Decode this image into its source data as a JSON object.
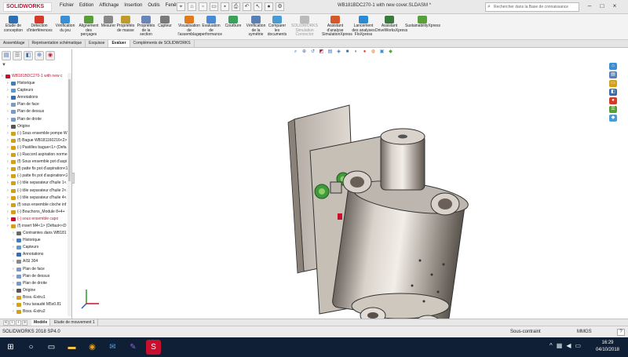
{
  "app": {
    "logo_text": "SOLIDWORKS",
    "document_title": "WB181BDC270-1 with new cover.SLDASM *"
  },
  "menu": [
    "Fichier",
    "Edition",
    "Affichage",
    "Insertion",
    "Outils",
    "Fenêtre",
    "?"
  ],
  "search": {
    "placeholder": "Rechercher dans la Base de connaissance"
  },
  "ribbon": [
    {
      "label": "Etude de conception",
      "color": "#2d6fb5"
    },
    {
      "label": "Détection d'interférences",
      "color": "#d43b2a"
    },
    {
      "label": "Vérification du jeu",
      "color": "#3a8ed4"
    },
    {
      "label": "Alignement des perçages",
      "color": "#5a9e3a"
    },
    {
      "label": "Mesurer",
      "color": "#888888"
    },
    {
      "label": "Propriétés de masse",
      "color": "#c09a2a"
    },
    {
      "label": "Propriétés de la section",
      "color": "#6a86b8"
    },
    {
      "label": "Capteur",
      "color": "#7a7a7a"
    },
    {
      "label": "Visualisation de l'assemblage",
      "color": "#e07a1a"
    },
    {
      "label": "Evaluation de performance",
      "color": "#4a8ad4"
    },
    {
      "label": "Courbure",
      "color": "#3aa05a"
    },
    {
      "label": "Vérification de la symétrie",
      "color": "#5a7fb5"
    },
    {
      "label": "Comparer les documents",
      "color": "#4a9ad4"
    },
    {
      "label": "SOLIDWORKS Simulation Connector",
      "color": "#bbbbbb",
      "disabled": true
    },
    {
      "label": "Assistant d'analyse SimulationXpress",
      "color": "#d45a2a"
    },
    {
      "label": "Lancement des analyses FloXpress",
      "color": "#2a8ad4"
    },
    {
      "label": "Assistant DriveWorksXpress",
      "color": "#3a7a3a"
    },
    {
      "label": "SustainabilityXpress",
      "color": "#5aa03a"
    }
  ],
  "tabs": [
    "Assemblage",
    "Représentation schématique",
    "Esquisse",
    "Evaluer",
    "Compléments de SOLIDWORKS"
  ],
  "active_tab": "Evaluer",
  "tree": [
    {
      "label": "WB181BDC270-1 with new c",
      "indent": 0,
      "color": "#c8102e",
      "red": true
    },
    {
      "label": "Historique",
      "indent": 1,
      "color": "#4a7ab5"
    },
    {
      "label": "Capteurs",
      "indent": 1,
      "color": "#5a9ad4"
    },
    {
      "label": "Annotations",
      "indent": 1,
      "color": "#3a6ab0"
    },
    {
      "label": "Plan de face",
      "indent": 1,
      "color": "#7a9ac8"
    },
    {
      "label": "Plan de dessus",
      "indent": 1,
      "color": "#7a9ac8"
    },
    {
      "label": "Plan de droite",
      "indent": 1,
      "color": "#7a9ac8"
    },
    {
      "label": "Origine",
      "indent": 1,
      "color": "#555555"
    },
    {
      "label": "(-) Sous ensemble pompe W",
      "indent": 1,
      "color": "#d4a017"
    },
    {
      "label": "(f) Bague WB181160216<2>",
      "indent": 1,
      "color": "#d4a017"
    },
    {
      "label": "(-) Pastilles bague<1> (Defa",
      "indent": 1,
      "color": "#d4a017"
    },
    {
      "label": "(-) Raccord aspiration norme",
      "indent": 1,
      "color": "#d4a017"
    },
    {
      "label": "(f) Sous ensemble pot d'aspi",
      "indent": 1,
      "color": "#d4a017"
    },
    {
      "label": "(f) patte fix pot d'aspiration<1",
      "indent": 1,
      "color": "#d4a017"
    },
    {
      "label": "(-) patte fix pot d'aspiration<2",
      "indent": 1,
      "color": "#d4a017"
    },
    {
      "label": "(-) tôle separateur d'huile 1<",
      "indent": 1,
      "color": "#d4a017"
    },
    {
      "label": "(-) tôle separateur d'huile 2<",
      "indent": 1,
      "color": "#d4a017"
    },
    {
      "label": "(-) tôle separateur d'huile 4<",
      "indent": 1,
      "color": "#d4a017"
    },
    {
      "label": "(f) sous ensemble cloche inf",
      "indent": 1,
      "color": "#d4a017"
    },
    {
      "label": "(-) Bouchons_Module 8+4+",
      "indent": 1,
      "color": "#d4a017"
    },
    {
      "label": "(-) sous ensemble capo",
      "indent": 1,
      "color": "#c8102e",
      "red": true
    },
    {
      "label": "(f) insert M4<1> (Défaut<<D",
      "indent": 1,
      "color": "#d4a017"
    },
    {
      "label": "Contraintes dans WB181",
      "indent": 2,
      "color": "#6a6a6a"
    },
    {
      "label": "Historique",
      "indent": 2,
      "color": "#4a7ab5"
    },
    {
      "label": "Capteurs",
      "indent": 2,
      "color": "#5a9ad4"
    },
    {
      "label": "Annotations",
      "indent": 2,
      "color": "#3a6ab0"
    },
    {
      "label": "AISI 304",
      "indent": 2,
      "color": "#8a8a8a"
    },
    {
      "label": "Plan de face",
      "indent": 2,
      "color": "#7a9ac8"
    },
    {
      "label": "Plan de dessus",
      "indent": 2,
      "color": "#7a9ac8"
    },
    {
      "label": "Plan de droite",
      "indent": 2,
      "color": "#7a9ac8"
    },
    {
      "label": "Origine",
      "indent": 2,
      "color": "#555555"
    },
    {
      "label": "Boss.-Extru1",
      "indent": 2,
      "color": "#d4a017"
    },
    {
      "label": "Trou taraudé M5x0.81",
      "indent": 2,
      "color": "#d4a017"
    },
    {
      "label": "Boss.-Extru2",
      "indent": 2,
      "color": "#d4a017"
    }
  ],
  "bottom_tabs": [
    "Modèle",
    "Etude de mouvement 1"
  ],
  "status": {
    "left": "SOLIDWORKS 2018 SP4.0",
    "mode": "Sous-contraint",
    "units": "MMGS",
    "help": "?"
  },
  "clock": {
    "time": "16:29",
    "date": "04/10/2018"
  },
  "taskbar_apps": [
    "start-icon",
    "search-icon",
    "task-view-icon",
    "file-explorer-icon",
    "chrome-icon",
    "mail-icon",
    "pen-icon",
    "solidworks-icon"
  ],
  "accent": "#c8102e"
}
